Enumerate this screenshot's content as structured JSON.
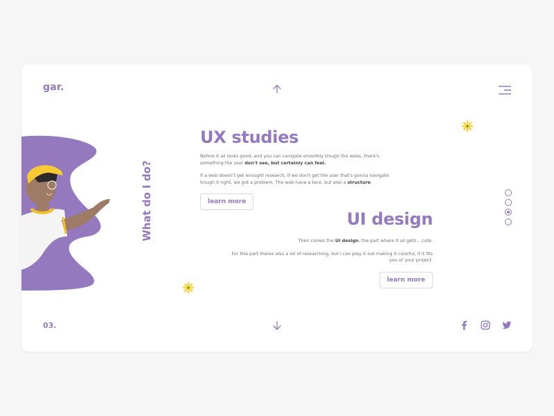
{
  "header": {
    "logo": "gar.",
    "menu_icon": "hamburger-menu-icon",
    "up_icon": "arrow-up-icon"
  },
  "side_title": "What do I do?",
  "sections": [
    {
      "title": "UX studies",
      "paragraphs": [
        {
          "text": "Before it all looks good, and you can navigate smoothly trough the webs, there's something the user ",
          "bold": "don't see, but certainly can feel.",
          "after": ""
        },
        {
          "text": "If a web doesn't get enought research, if we don't get the user that's gonna navigate trough it right, we got a problem. The web have a face, but also a ",
          "bold": "structure",
          "after": "."
        }
      ],
      "button_label": "learn more"
    },
    {
      "title": "UI design",
      "paragraphs": [
        {
          "text": "Then comes the ",
          "bold": "UI design",
          "after": ", the part where it all gets... cute."
        },
        {
          "text": "For this part theres also a lot of researching, but I can play it out making it colorful, if it fits you or your project.",
          "bold": "",
          "after": ""
        }
      ],
      "button_label": "learn more"
    }
  ],
  "pager": {
    "total": 4,
    "active_index": 2
  },
  "footer": {
    "page_number": "03.",
    "down_icon": "arrow-down-icon",
    "social": [
      {
        "name": "facebook",
        "icon": "facebook-icon"
      },
      {
        "name": "instagram",
        "icon": "instagram-icon"
      },
      {
        "name": "twitter",
        "icon": "twitter-icon"
      }
    ]
  },
  "colors": {
    "accent": "#9579bf",
    "flower": "#f7d03c",
    "background": "#f6f6f6",
    "card": "#ffffff"
  }
}
